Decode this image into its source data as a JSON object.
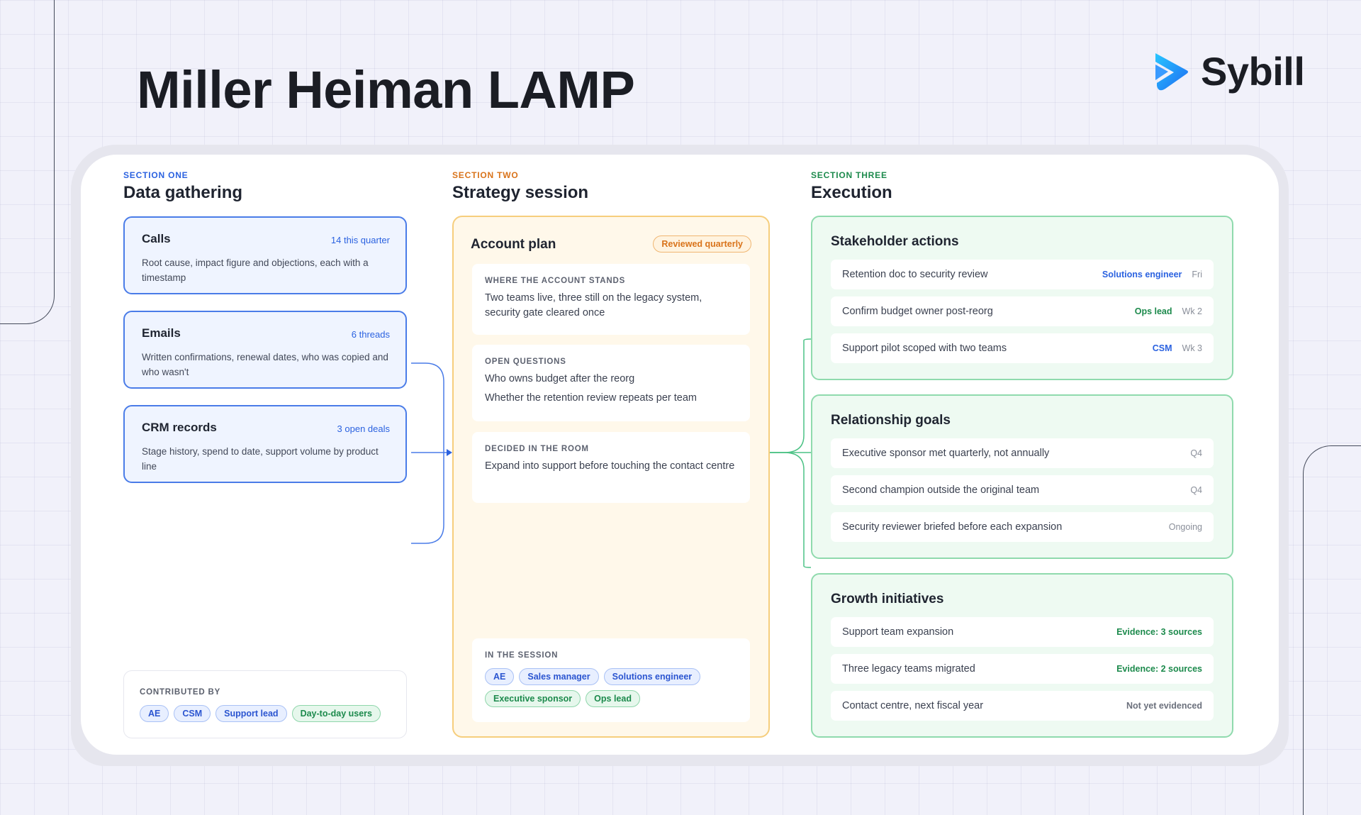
{
  "page": {
    "title": "Miller Heiman LAMP",
    "brand": "Sybill"
  },
  "colors": {
    "blue": "#2b62e0",
    "orange": "#d9731a",
    "green": "#1c8a4c"
  },
  "sections": {
    "one": {
      "kicker": "SECTION ONE",
      "title": "Data gathering"
    },
    "two": {
      "kicker": "SECTION TWO",
      "title": "Strategy session"
    },
    "three": {
      "kicker": "SECTION THREE",
      "title": "Execution"
    }
  },
  "sources": [
    {
      "name": "Calls",
      "meta": "14 this quarter",
      "desc": "Root cause, impact figure and objections, each with a timestamp"
    },
    {
      "name": "Emails",
      "meta": "6 threads",
      "desc": "Written confirmations, renewal dates, who was copied and who wasn't"
    },
    {
      "name": "CRM records",
      "meta": "3 open deals",
      "desc": "Stage history, spend to date, support volume by product line"
    }
  ],
  "contributed": {
    "label": "CONTRIBUTED BY",
    "chips": [
      "AE",
      "CSM",
      "Support lead",
      "Day-to-day users"
    ]
  },
  "plan": {
    "title": "Account plan",
    "badge": "Reviewed quarterly",
    "stands": {
      "label": "WHERE THE ACCOUNT STANDS",
      "text": "Two teams live, three still on the legacy system, security gate cleared once"
    },
    "questions": {
      "label": "OPEN QUESTIONS",
      "items": [
        "Who owns budget after the reorg",
        "Whether the retention review repeats per team"
      ]
    },
    "decided": {
      "label": "DECIDED IN THE ROOM",
      "text": "Expand into support before touching the contact centre"
    },
    "session": {
      "label": "IN THE SESSION",
      "chips": [
        "AE",
        "Sales manager",
        "Solutions engineer",
        "Executive sponsor",
        "Ops lead"
      ]
    }
  },
  "stakeholder": {
    "title": "Stakeholder actions",
    "rows": [
      {
        "text": "Retention doc to security review",
        "owner": "Solutions engineer",
        "when": "Fri"
      },
      {
        "text": "Confirm budget owner post-reorg",
        "owner": "Ops lead",
        "when": "Wk 2"
      },
      {
        "text": "Support pilot scoped with two teams",
        "owner": "CSM",
        "when": "Wk 3"
      }
    ]
  },
  "relationship": {
    "title": "Relationship goals",
    "rows": [
      {
        "text": "Executive sponsor met quarterly, not annually",
        "when": "Q4"
      },
      {
        "text": "Second champion outside the original team",
        "when": "Q4"
      },
      {
        "text": "Security reviewer briefed before each expansion",
        "when": "Ongoing"
      }
    ]
  },
  "growth": {
    "title": "Growth initiatives",
    "rows": [
      {
        "text": "Support team expansion",
        "evidence": "Evidence: 3 sources"
      },
      {
        "text": "Three legacy teams migrated",
        "evidence": "Evidence: 2 sources"
      },
      {
        "text": "Contact centre, next fiscal year",
        "evidence": "Not yet evidenced"
      }
    ]
  }
}
